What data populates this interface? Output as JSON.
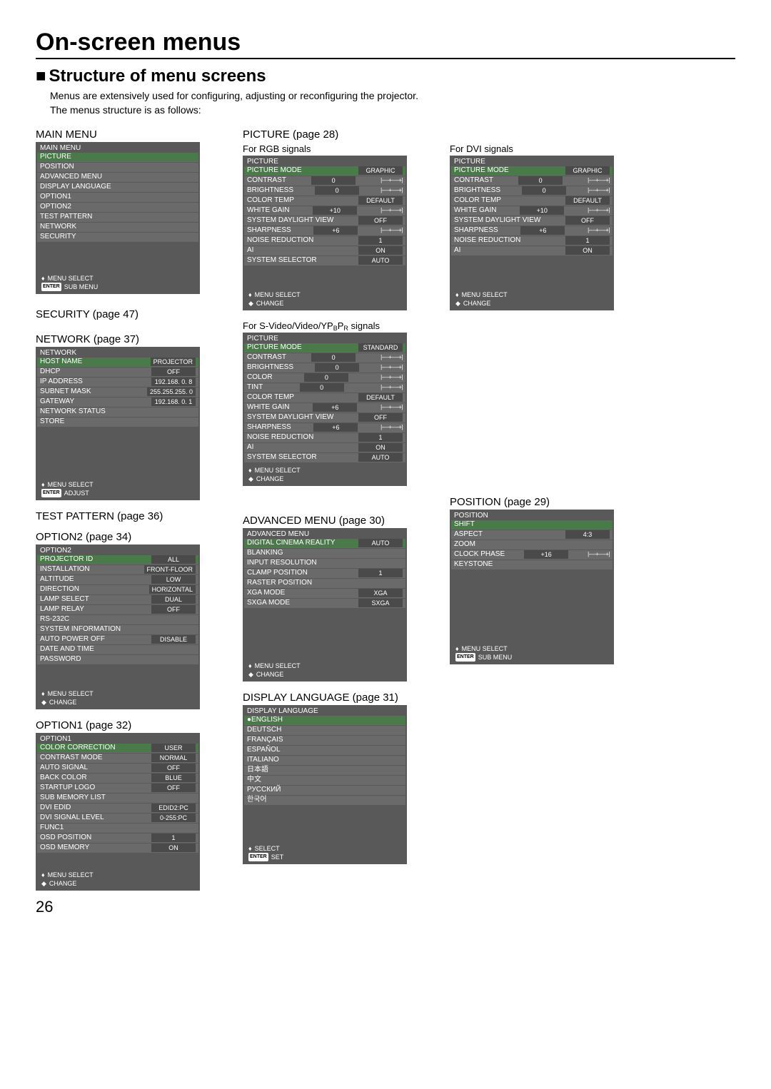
{
  "page_title": "On-screen menus",
  "section_title": "Structure of menu screens",
  "intro_line1": "Menus are extensively used for configuring, adjusting or reconfiguring the projector.",
  "intro_line2": "The menus structure is as follows:",
  "page_number": "26",
  "labels": {
    "main_menu": "MAIN MENU",
    "security": "SECURITY (page 47)",
    "network": "NETWORK (page 37)",
    "test_pattern": "TEST PATTERN (page 36)",
    "option2": "OPTION2 (page 34)",
    "option1": "OPTION1 (page 32)",
    "picture": "PICTURE (page 28)",
    "for_rgb": "For RGB signals",
    "for_dvi": "For DVI signals",
    "for_svideo": "For S-Video/Video/YPBPR signals",
    "advanced_menu": "ADVANCED MENU (page 30)",
    "display_language": "DISPLAY LANGUAGE (page 31)",
    "position": "POSITION (page 29)"
  },
  "footer": {
    "menu_select": "MENU SELECT",
    "sub_menu": "SUB MENU",
    "change": "CHANGE",
    "adjust": "ADJUST",
    "select": "SELECT",
    "set": "SET",
    "enter": "ENTER"
  },
  "main_menu": {
    "title": "MAIN MENU",
    "items": [
      "PICTURE",
      "POSITION",
      "ADVANCED MENU",
      "DISPLAY LANGUAGE",
      "OPTION1",
      "OPTION2",
      "TEST PATTERN",
      "NETWORK",
      "SECURITY"
    ]
  },
  "network_menu": {
    "title": "NETWORK",
    "rows": [
      {
        "label": "HOST NAME",
        "val": "PROJECTOR"
      },
      {
        "label": "DHCP",
        "val": "OFF"
      },
      {
        "label": "IP ADDRESS",
        "val": "192.168.   0.   8"
      },
      {
        "label": "SUBNET MASK",
        "val": "255.255.255.   0"
      },
      {
        "label": "GATEWAY",
        "val": "192.168.   0.   1"
      },
      {
        "label": "NETWORK STATUS",
        "val": ""
      },
      {
        "label": "STORE",
        "val": ""
      }
    ]
  },
  "option2_menu": {
    "title": "OPTION2",
    "rows": [
      {
        "label": "PROJECTOR ID",
        "val": "ALL"
      },
      {
        "label": "INSTALLATION",
        "val": "FRONT-FLOOR"
      },
      {
        "label": "ALTITUDE",
        "val": "LOW"
      },
      {
        "label": "DIRECTION",
        "val": "HORIZONTAL"
      },
      {
        "label": "LAMP SELECT",
        "val": "DUAL"
      },
      {
        "label": "LAMP RELAY",
        "val": "OFF"
      },
      {
        "label": "RS-232C",
        "val": ""
      },
      {
        "label": "SYSTEM INFORMATION",
        "val": ""
      },
      {
        "label": "AUTO POWER OFF",
        "val": "DISABLE"
      },
      {
        "label": "DATE AND TIME",
        "val": ""
      },
      {
        "label": "PASSWORD",
        "val": ""
      }
    ]
  },
  "option1_menu": {
    "title": "OPTION1",
    "rows": [
      {
        "label": "COLOR CORRECTION",
        "val": "USER"
      },
      {
        "label": "CONTRAST MODE",
        "val": "NORMAL"
      },
      {
        "label": "AUTO SIGNAL",
        "val": "OFF"
      },
      {
        "label": "BACK COLOR",
        "val": "BLUE"
      },
      {
        "label": "STARTUP LOGO",
        "val": "OFF"
      },
      {
        "label": "SUB MEMORY LIST",
        "val": ""
      },
      {
        "label": "DVI EDID",
        "val": "EDID2:PC"
      },
      {
        "label": "DVI SIGNAL LEVEL",
        "val": "0-255:PC"
      },
      {
        "label": "FUNC1",
        "val": ""
      },
      {
        "label": "OSD POSITION",
        "val": "1"
      },
      {
        "label": "OSD MEMORY",
        "val": "ON"
      }
    ]
  },
  "picture_rgb": {
    "title": "PICTURE",
    "rows": [
      {
        "label": "PICTURE MODE",
        "val": "GRAPHIC"
      },
      {
        "label": "CONTRAST",
        "val": "0",
        "slider": true
      },
      {
        "label": "BRIGHTNESS",
        "val": "0",
        "slider": true
      },
      {
        "label": "COLOR TEMP",
        "val": "DEFAULT"
      },
      {
        "label": "WHITE GAIN",
        "val": "+10",
        "slider": true
      },
      {
        "label": "SYSTEM DAYLIGHT VIEW",
        "val": "OFF"
      },
      {
        "label": "SHARPNESS",
        "val": "+6",
        "slider": true
      },
      {
        "label": "NOISE REDUCTION",
        "val": "1"
      },
      {
        "label": "AI",
        "val": "ON"
      },
      {
        "label": "SYSTEM SELECTOR",
        "val": "AUTO"
      }
    ]
  },
  "picture_dvi": {
    "title": "PICTURE",
    "rows": [
      {
        "label": "PICTURE MODE",
        "val": "GRAPHIC"
      },
      {
        "label": "CONTRAST",
        "val": "0",
        "slider": true
      },
      {
        "label": "BRIGHTNESS",
        "val": "0",
        "slider": true
      },
      {
        "label": "COLOR TEMP",
        "val": "DEFAULT"
      },
      {
        "label": "WHITE GAIN",
        "val": "+10",
        "slider": true
      },
      {
        "label": "SYSTEM DAYLIGHT VIEW",
        "val": "OFF"
      },
      {
        "label": "SHARPNESS",
        "val": "+6",
        "slider": true
      },
      {
        "label": "NOISE REDUCTION",
        "val": "1"
      },
      {
        "label": "AI",
        "val": "ON"
      }
    ]
  },
  "picture_svideo": {
    "title": "PICTURE",
    "rows": [
      {
        "label": "PICTURE MODE",
        "val": "STANDARD"
      },
      {
        "label": "CONTRAST",
        "val": "0",
        "slider": true
      },
      {
        "label": "BRIGHTNESS",
        "val": "0",
        "slider": true
      },
      {
        "label": "COLOR",
        "val": "0",
        "slider": true
      },
      {
        "label": "TINT",
        "val": "0",
        "slider": true
      },
      {
        "label": "COLOR TEMP",
        "val": "DEFAULT"
      },
      {
        "label": "WHITE GAIN",
        "val": "+6",
        "slider": true
      },
      {
        "label": "SYSTEM DAYLIGHT VIEW",
        "val": "OFF"
      },
      {
        "label": "SHARPNESS",
        "val": "+6",
        "slider": true
      },
      {
        "label": "NOISE REDUCTION",
        "val": "1"
      },
      {
        "label": "AI",
        "val": "ON"
      },
      {
        "label": "SYSTEM SELECTOR",
        "val": "AUTO"
      }
    ]
  },
  "advanced_menu": {
    "title": "ADVANCED MENU",
    "rows": [
      {
        "label": "DIGITAL CINEMA REALITY",
        "val": "AUTO"
      },
      {
        "label": "BLANKING",
        "val": ""
      },
      {
        "label": "INPUT RESOLUTION",
        "val": ""
      },
      {
        "label": "CLAMP POSITION",
        "val": "1"
      },
      {
        "label": "RASTER POSITION",
        "val": ""
      },
      {
        "label": "XGA MODE",
        "val": "XGA"
      },
      {
        "label": "SXGA MODE",
        "val": "SXGA"
      }
    ]
  },
  "display_language_menu": {
    "title": "DISPLAY LANGUAGE",
    "items": [
      "ENGLISH",
      "DEUTSCH",
      "FRANÇAIS",
      "ESPAÑOL",
      "ITALIANO",
      "日本語",
      "中文",
      "РУССКИЙ",
      "한국어"
    ]
  },
  "position_menu": {
    "title": "POSITION",
    "rows": [
      {
        "label": "SHIFT",
        "val": ""
      },
      {
        "label": "ASPECT",
        "val": "4:3"
      },
      {
        "label": "ZOOM",
        "val": ""
      },
      {
        "label": "CLOCK PHASE",
        "val": "+16",
        "slider": true
      },
      {
        "label": "KEYSTONE",
        "val": ""
      }
    ]
  }
}
